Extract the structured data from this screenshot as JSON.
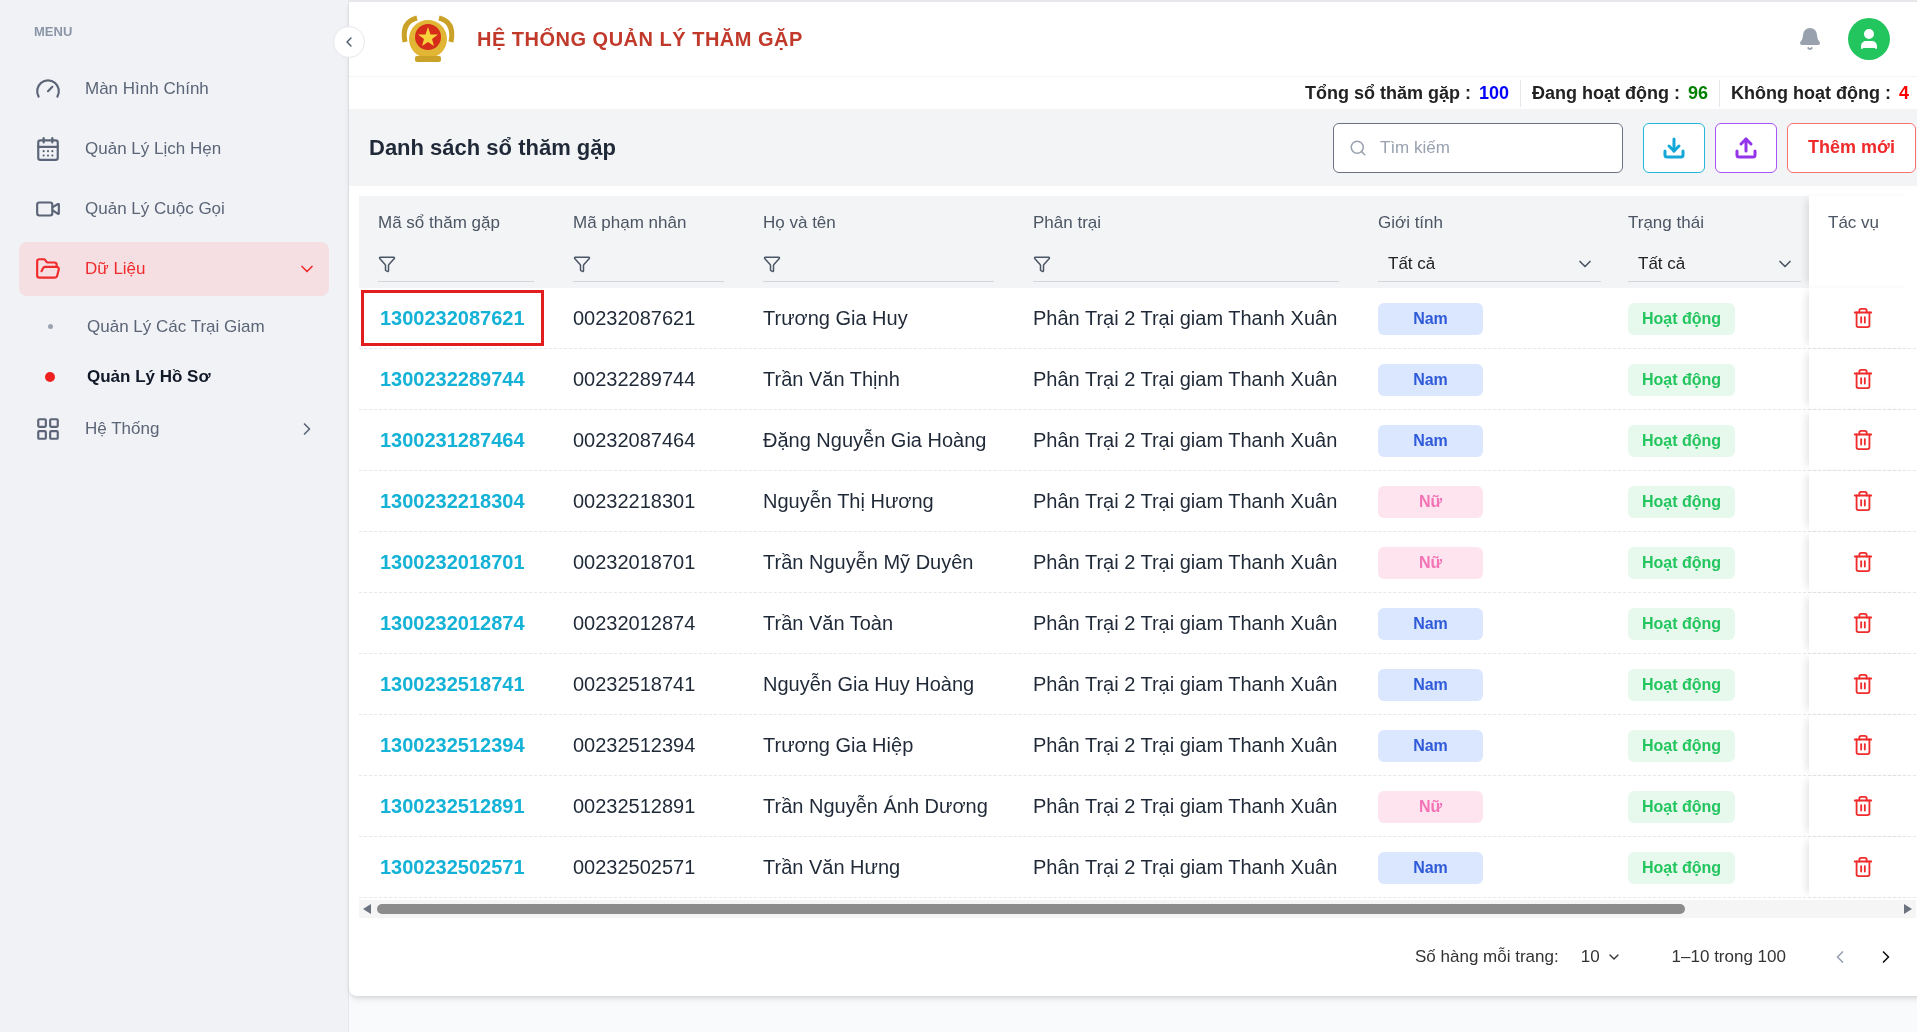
{
  "sidebar": {
    "heading": "MENU",
    "items": [
      {
        "label": "Màn Hình Chính",
        "kind": "item",
        "selected": false
      },
      {
        "label": "Quản Lý Lịch Hẹn",
        "kind": "item",
        "selected": false
      },
      {
        "label": "Quản Lý Cuộc Gọi",
        "kind": "item",
        "selected": false
      },
      {
        "label": "Dữ Liệu",
        "kind": "group",
        "selected": true,
        "expanded": true,
        "children": [
          {
            "label": "Quản Lý Các Trại Giam",
            "selected": false
          },
          {
            "label": "Quản Lý Hồ Sơ",
            "selected": true
          }
        ]
      },
      {
        "label": "Hệ Thống",
        "kind": "group",
        "selected": false,
        "expanded": false
      }
    ]
  },
  "header": {
    "title": "HỆ THỐNG QUẢN LÝ THĂM GẶP"
  },
  "stats": [
    {
      "label": "Tổng sổ thăm gặp :",
      "value": "100",
      "color": "#0000ff"
    },
    {
      "label": "Đang hoạt động :",
      "value": "96",
      "color": "#008000"
    },
    {
      "label": "Không hoạt động :",
      "value": "4",
      "color": "#ff0000"
    }
  ],
  "card": {
    "title": "Danh sách sổ thăm gặp",
    "search": {
      "placeholder": "Tìm kiếm"
    },
    "add_button": "Thêm mới"
  },
  "table": {
    "columns": [
      {
        "label": "Mã sổ thăm gặp",
        "kind": "text"
      },
      {
        "label": "Mã phạm nhân",
        "kind": "text"
      },
      {
        "label": "Họ và tên",
        "kind": "text"
      },
      {
        "label": "Phân trại",
        "kind": "text"
      },
      {
        "label": "Giới tính",
        "kind": "select",
        "value": "Tất cả"
      },
      {
        "label": "Trạng thái",
        "kind": "select",
        "value": "Tất cả"
      },
      {
        "label": "Tác vụ",
        "kind": "plain"
      }
    ],
    "rows": [
      {
        "code": "1300232087621",
        "highlighted": true,
        "prisoner_id": "00232087621",
        "name": "Trương Gia Huy",
        "camp": "Phân Trại 2 Trại giam Thanh Xuân",
        "gender": {
          "label": "Nam",
          "kind": "male"
        },
        "status": "Hoạt động"
      },
      {
        "code": "1300232289744",
        "highlighted": false,
        "prisoner_id": "00232289744",
        "name": "Trần Văn Thịnh",
        "camp": "Phân Trại 2 Trại giam Thanh Xuân",
        "gender": {
          "label": "Nam",
          "kind": "male"
        },
        "status": "Hoạt động"
      },
      {
        "code": "1300231287464",
        "highlighted": false,
        "prisoner_id": "00232087464",
        "name": "Đặng Nguyễn Gia Hoàng",
        "camp": "Phân Trại 2 Trại giam Thanh Xuân",
        "gender": {
          "label": "Nam",
          "kind": "male"
        },
        "status": "Hoạt động"
      },
      {
        "code": "1300232218304",
        "highlighted": false,
        "prisoner_id": "00232218301",
        "name": "Nguyễn Thị Hương",
        "camp": "Phân Trại 2 Trại giam Thanh Xuân",
        "gender": {
          "label": "Nữ",
          "kind": "female"
        },
        "status": "Hoạt động"
      },
      {
        "code": "1300232018701",
        "highlighted": false,
        "prisoner_id": "00232018701",
        "name": "Trần Nguyễn Mỹ Duyên",
        "camp": "Phân Trại 2 Trại giam Thanh Xuân",
        "gender": {
          "label": "Nữ",
          "kind": "female"
        },
        "status": "Hoạt động"
      },
      {
        "code": "1300232012874",
        "highlighted": false,
        "prisoner_id": "00232012874",
        "name": "Trần Văn Toàn",
        "camp": "Phân Trại 2 Trại giam Thanh Xuân",
        "gender": {
          "label": "Nam",
          "kind": "male"
        },
        "status": "Hoạt động"
      },
      {
        "code": "1300232518741",
        "highlighted": false,
        "prisoner_id": "00232518741",
        "name": "Nguyễn Gia Huy Hoàng",
        "camp": "Phân Trại 2 Trại giam Thanh Xuân",
        "gender": {
          "label": "Nam",
          "kind": "male"
        },
        "status": "Hoạt động"
      },
      {
        "code": "1300232512394",
        "highlighted": false,
        "prisoner_id": "00232512394",
        "name": "Trương Gia Hiệp",
        "camp": "Phân Trại 2 Trại giam Thanh Xuân",
        "gender": {
          "label": "Nam",
          "kind": "male"
        },
        "status": "Hoạt động"
      },
      {
        "code": "1300232512891",
        "highlighted": false,
        "prisoner_id": "00232512891",
        "name": "Trần Nguyễn Ánh Dương",
        "camp": "Phân Trại 2 Trại giam Thanh Xuân",
        "gender": {
          "label": "Nữ",
          "kind": "female"
        },
        "status": "Hoạt động"
      },
      {
        "code": "1300232502571",
        "highlighted": false,
        "prisoner_id": "00232502571",
        "name": "Trần Văn Hưng",
        "camp": "Phân Trại 2 Trại giam Thanh Xuân",
        "gender": {
          "label": "Nam",
          "kind": "male"
        },
        "status": "Hoạt động"
      }
    ]
  },
  "pagination": {
    "rows_label": "Số hàng mỗi trang:",
    "rows_value": "10",
    "range": "1–10 trong 100"
  }
}
